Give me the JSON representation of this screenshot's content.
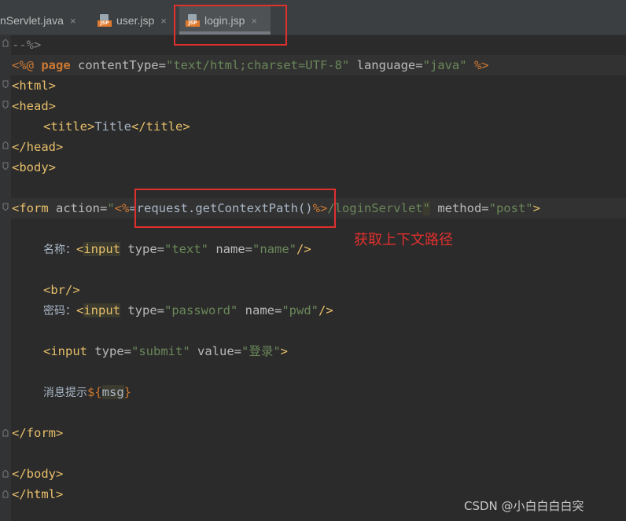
{
  "tabs": [
    {
      "label": "nServlet.java",
      "icon": "java-file-icon"
    },
    {
      "label": "user.jsp",
      "icon": "jsp-file-icon"
    },
    {
      "label": "login.jsp",
      "icon": "jsp-file-icon",
      "active": true
    }
  ],
  "close_glyph": "×",
  "jsp_icon_text": "JSP",
  "code": {
    "l0": "--%>",
    "l1": {
      "a": "<%@ ",
      "b": "page",
      "c": " contentType=",
      "d": "\"text/html;charset=UTF-8\"",
      "e": " language=",
      "f": "\"java\"",
      "g": " %>"
    },
    "l2": "<html>",
    "l3": "<head>",
    "l4": {
      "a": "<title>",
      "b": "Title",
      "c": "</title>"
    },
    "l5": "</head>",
    "l6": "<body>",
    "l8": {
      "a": "<form ",
      "b": "action=",
      "c": "\"",
      "d": "<%",
      "e": "=request.getContextPath()",
      "f": "%>",
      "g": "/loginServlet",
      "h": "\"",
      "i": " method=",
      "j": "\"post\"",
      "k": ">"
    },
    "l10": {
      "a": "名称：",
      "b": "<",
      "c": "input",
      "d": " type=",
      "e": "\"text\"",
      "f": " name=",
      "g": "\"name\"",
      "h": "/>"
    },
    "l12": "<br/>",
    "l13": {
      "a": "密码：",
      "b": "<",
      "c": "input",
      "d": " type=",
      "e": "\"password\"",
      "f": " name=",
      "g": "\"pwd\"",
      "h": "/>"
    },
    "l15": {
      "a": "<input ",
      "b": "type=",
      "c": "\"submit\"",
      "d": " value=",
      "e": "\"登录\"",
      "f": ">"
    },
    "l17": {
      "a": "消息提示",
      "b": "${",
      "c": "msg",
      "d": "}"
    },
    "l19": "</form>",
    "l21": "</body>",
    "l22": "</html>"
  },
  "annotation": "获取上下文路径",
  "watermark": "CSDN @小白白白白突",
  "colors": {
    "highlight_box": "#e0302e",
    "tag": "#e8bf6a",
    "string": "#6a8759",
    "keyword": "#cc7832",
    "text": "#a9b7c6"
  }
}
